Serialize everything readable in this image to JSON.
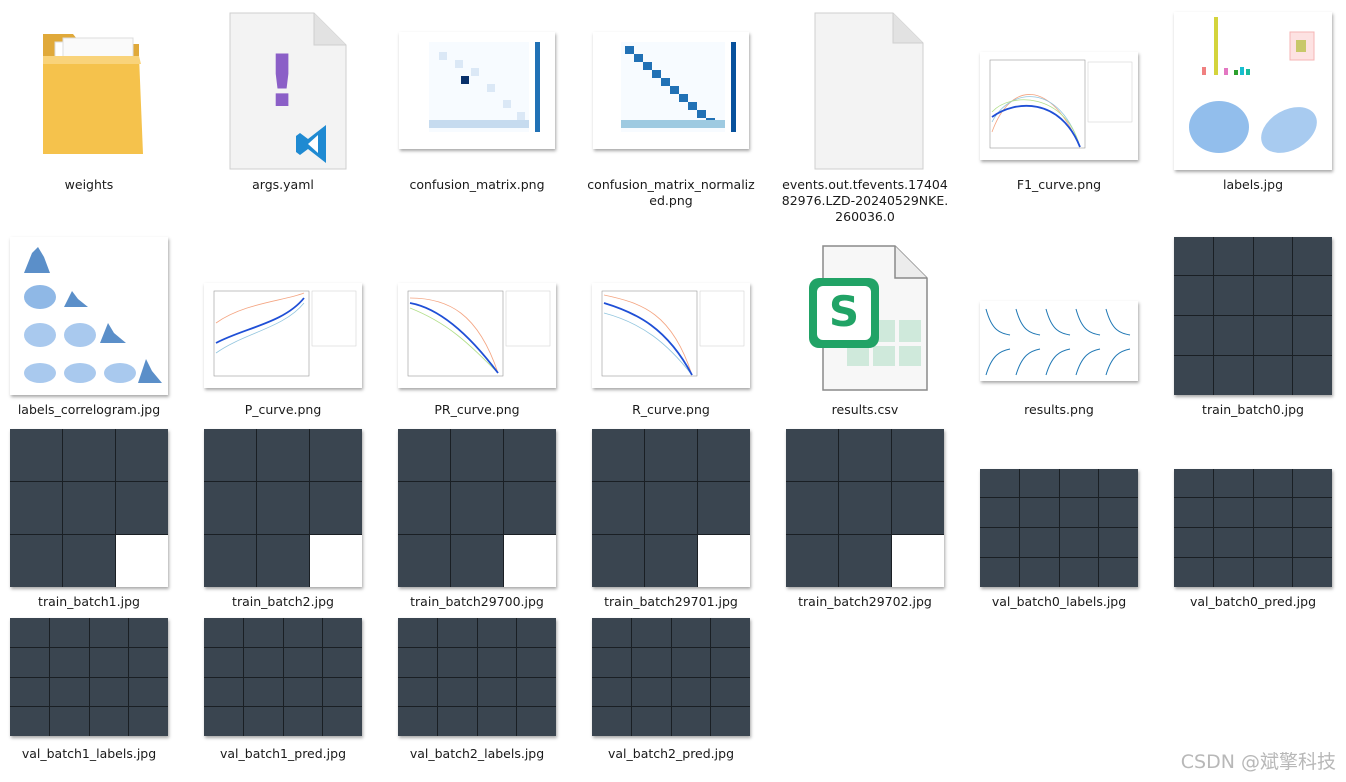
{
  "files": [
    {
      "label": "weights"
    },
    {
      "label": "args.yaml"
    },
    {
      "label": "confusion_matrix.png"
    },
    {
      "label": "confusion_matrix_normalized.png"
    },
    {
      "label": "events.out.tfevents.1740482976.LZD-20240529NKE.260036.0"
    },
    {
      "label": "F1_curve.png"
    },
    {
      "label": "labels.jpg"
    },
    {
      "label": "labels_correlogram.jpg"
    },
    {
      "label": "P_curve.png"
    },
    {
      "label": "PR_curve.png"
    },
    {
      "label": "R_curve.png"
    },
    {
      "label": "results.csv"
    },
    {
      "label": "results.png"
    },
    {
      "label": "train_batch0.jpg"
    },
    {
      "label": "train_batch1.jpg"
    },
    {
      "label": "train_batch2.jpg"
    },
    {
      "label": "train_batch29700.jpg"
    },
    {
      "label": "train_batch29701.jpg"
    },
    {
      "label": "train_batch29702.jpg"
    },
    {
      "label": "val_batch0_labels.jpg"
    },
    {
      "label": "val_batch0_pred.jpg"
    },
    {
      "label": "val_batch1_labels.jpg"
    },
    {
      "label": "val_batch1_pred.jpg"
    },
    {
      "label": "val_batch2_labels.jpg"
    },
    {
      "label": "val_batch2_pred.jpg"
    }
  ],
  "csv_icon_letter": "S",
  "yaml_icon_glyph": "!",
  "icons": {
    "folder": "folder-icon",
    "yaml": "yaml-file-icon",
    "blank": "blank-file-icon",
    "csv": "spreadsheet-file-icon",
    "vscode": "vscode-badge-icon"
  },
  "colors": {
    "folder": "#f5c24c",
    "csv_green": "#21a366",
    "yaml_purple": "#8b5fc7",
    "vscode_blue": "#1f8ad2",
    "chart_blue": "#1f4fd6"
  },
  "watermark": "CSDN @斌擎科技"
}
